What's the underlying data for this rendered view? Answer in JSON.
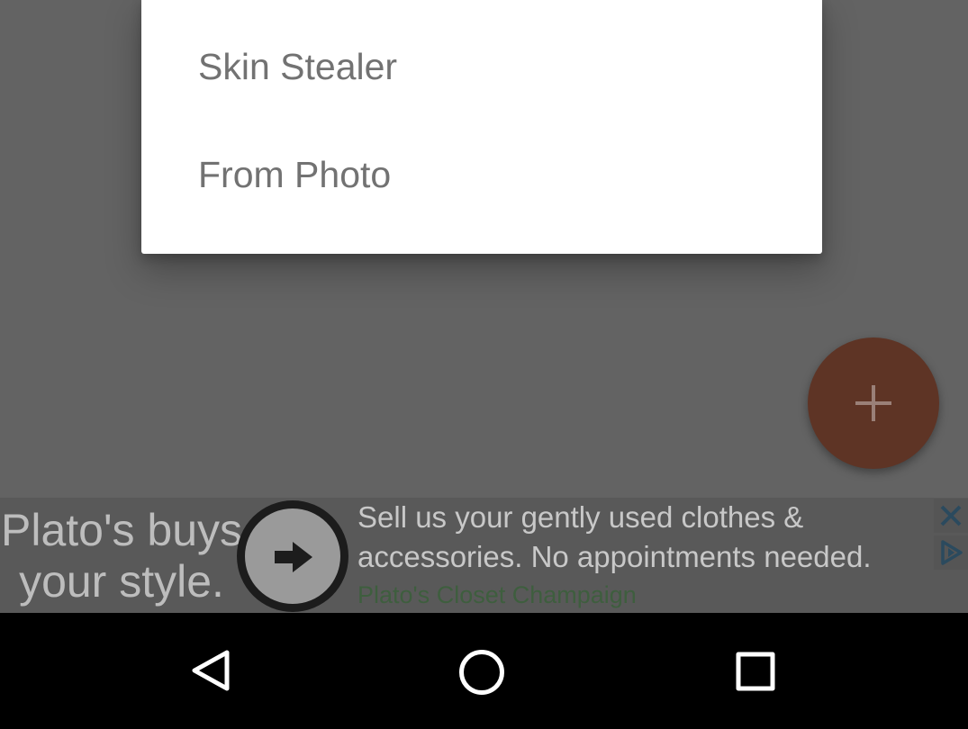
{
  "menu": {
    "items": [
      {
        "label": "Skin Stealer"
      },
      {
        "label": "From Photo"
      }
    ]
  },
  "fab": {
    "icon": "plus-icon",
    "color": "#5e3425"
  },
  "ad": {
    "headline": "Plato's buys your style.",
    "body": "Sell us your gently used clothes & accessories. No appointments needed.",
    "source": "Plato's Closet Champaign",
    "arrow_icon": "arrow-right-icon",
    "close_icon": "close-icon",
    "adchoices_icon": "adchoices-icon",
    "accent_color": "#3e5e3e"
  },
  "nav": {
    "back_icon": "back-triangle-icon",
    "home_icon": "home-circle-icon",
    "recents_icon": "recents-square-icon"
  }
}
